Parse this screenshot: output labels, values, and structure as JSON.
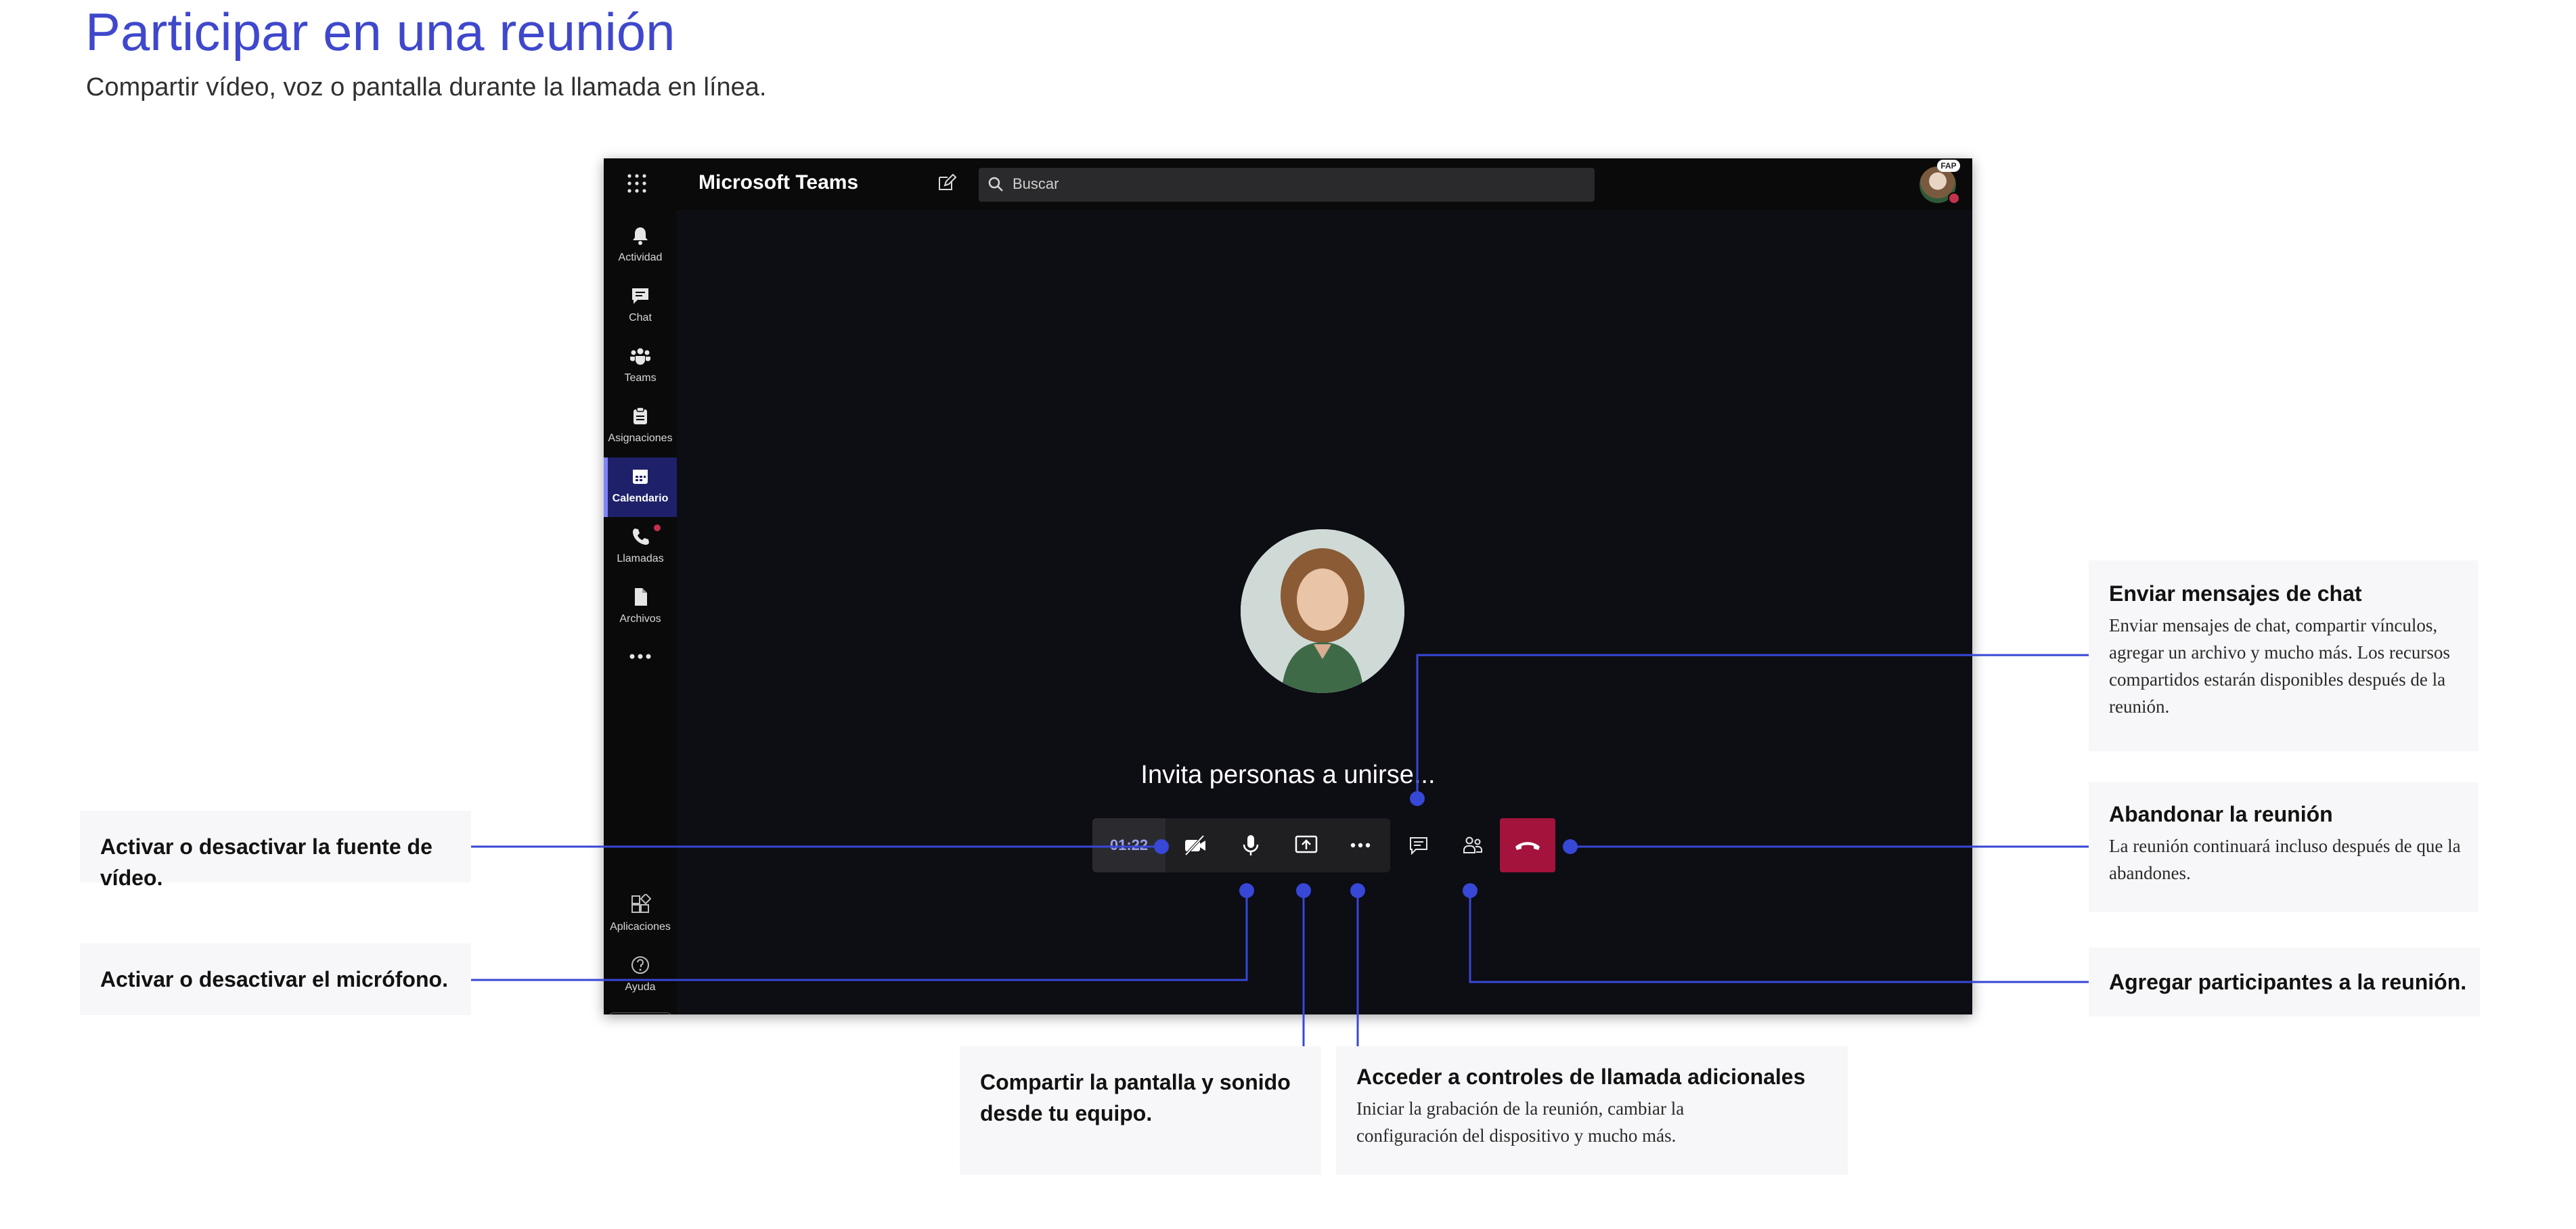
{
  "header": {
    "title": "Participar en una reunión",
    "subtitle": "Compartir vídeo, voz o pantalla durante la llamada en línea."
  },
  "teams": {
    "app_name": "Microsoft Teams",
    "search_placeholder": "Buscar",
    "avatar_badge": "FAP",
    "rail": [
      {
        "label": "Actividad",
        "icon": "bell-icon"
      },
      {
        "label": "Chat",
        "icon": "chat-icon"
      },
      {
        "label": "Teams",
        "icon": "teams-icon"
      },
      {
        "label": "Asignaciones",
        "icon": "assignments-icon"
      },
      {
        "label": "Calendario",
        "icon": "calendar-icon",
        "active": true
      },
      {
        "label": "Llamadas",
        "icon": "phone-icon"
      },
      {
        "label": "Archivos",
        "icon": "file-icon"
      }
    ],
    "rail_bottom": [
      {
        "label": "Aplicaciones",
        "icon": "apps-icon"
      },
      {
        "label": "Ayuda",
        "icon": "help-icon"
      }
    ],
    "meeting": {
      "invite_text": "Invita personas a unirse...",
      "timer": "01:22"
    },
    "colors": {
      "accent": "#3f48cc",
      "active_rail": "#1e2169",
      "hangup": "#a4133c",
      "connector": "#3747d6"
    }
  },
  "callouts": {
    "video": {
      "title": "Activar o desactivar la fuente de vídeo."
    },
    "mic": {
      "title": "Activar o desactivar el micrófono."
    },
    "share": {
      "title": "Compartir la pantalla y sonido desde tu equipo."
    },
    "more": {
      "title": "Acceder  a controles de llamada adicionales",
      "body": "Iniciar la grabación de la reunión, cambiar la configuración del dispositivo y mucho más."
    },
    "chat": {
      "title": "Enviar mensajes de chat",
      "body": "Enviar mensajes de chat, compartir vínculos, agregar un archivo y mucho más. Los recursos compartidos estarán disponibles después de la reunión."
    },
    "leave": {
      "title": "Abandonar la reunión",
      "body": "La reunión continuará incluso después de que la abandones."
    },
    "participants": {
      "title": "Agregar participantes a la reunión."
    }
  }
}
